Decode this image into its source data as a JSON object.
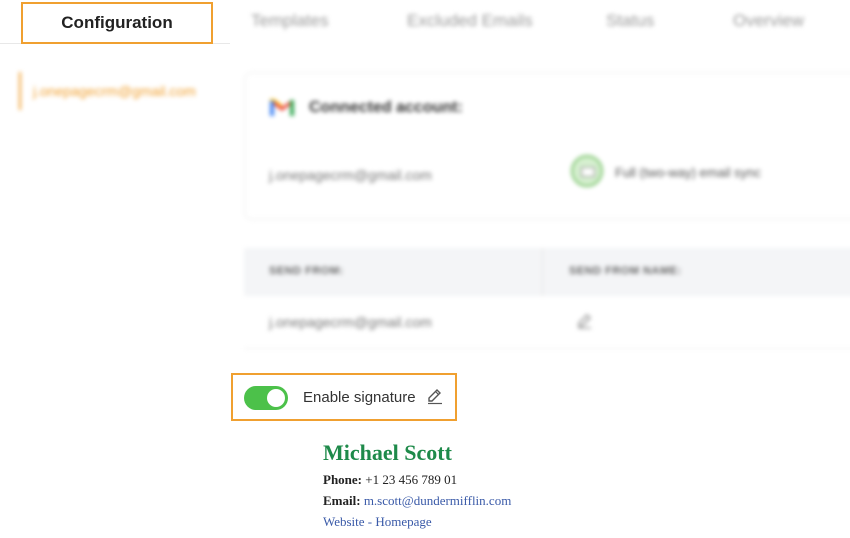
{
  "tabs": [
    {
      "label": "Configuration",
      "active": true
    },
    {
      "label": "Templates",
      "active": false
    },
    {
      "label": "Excluded Emails",
      "active": false
    },
    {
      "label": "Status",
      "active": false
    },
    {
      "label": "Overview",
      "active": false
    }
  ],
  "sidebar": {
    "items": [
      {
        "label": "j.onepagecrm@gmail.com"
      }
    ]
  },
  "account_card": {
    "title": "Connected account:",
    "email": "j.onepagecrm@gmail.com",
    "sync_mode": "Full (two-way) email sync"
  },
  "send_table": {
    "columns": [
      "SEND FROM:",
      "SEND FROM NAME:"
    ],
    "rows": [
      {
        "send_from": "j.onepagecrm@gmail.com",
        "send_from_name": ""
      }
    ]
  },
  "signature_toggle": {
    "label": "Enable signature",
    "enabled": true
  },
  "signature": {
    "name": "Michael Scott",
    "phone_label": "Phone:",
    "phone": "+1 23 456 789 01",
    "email_label": "Email:",
    "email": "m.scott@dundermifflin.com",
    "website_text": "Website - Homepage"
  },
  "colors": {
    "accent": "#f0a030",
    "toggle_on": "#4cc14a",
    "signature_name": "#1e8a4a",
    "link": "#3a5aa8"
  }
}
